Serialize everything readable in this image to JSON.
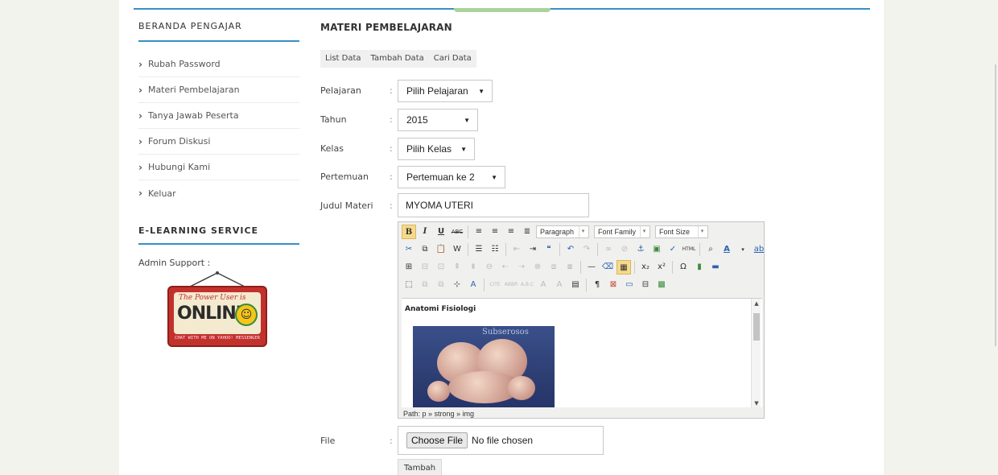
{
  "sidebar": {
    "title": "BERANDA PENGAJAR",
    "items": [
      {
        "label": "Rubah Password"
      },
      {
        "label": "Materi Pembelajaran"
      },
      {
        "label": "Tanya Jawab Peserta"
      },
      {
        "label": "Forum Diskusi"
      },
      {
        "label": "Hubungi Kami"
      },
      {
        "label": "Keluar"
      }
    ],
    "service_title": "E-LEARNING SERVICE",
    "admin_label": "Admin Support :",
    "sign": {
      "small": "The Power User is",
      "big": "ONLINE",
      "foot": "CHAT WITH ME ON YAHOO! MESSENGER"
    }
  },
  "main": {
    "title": "MATERI PEMBELAJARAN",
    "tabs": [
      {
        "label": "List Data"
      },
      {
        "label": "Tambah Data"
      },
      {
        "label": "Cari Data"
      }
    ],
    "colon": ":",
    "fields": {
      "pelajaran": {
        "label": "Pelajaran",
        "value": "Pilih Pelajaran"
      },
      "tahun": {
        "label": "Tahun",
        "value": "2015"
      },
      "kelas": {
        "label": "Kelas",
        "value": "Pilih Kelas"
      },
      "pertemuan": {
        "label": "Pertemuan",
        "value": "Pertemuan ke 2"
      },
      "judul": {
        "label": "Judul Materi",
        "value": "MYOMA UTERI"
      },
      "file": {
        "label": "File",
        "button": "Choose File",
        "status": "No file chosen"
      }
    },
    "editor": {
      "format_dropdown": "Paragraph",
      "font_family_dropdown": "Font Family",
      "font_size_dropdown": "Font Size",
      "content_heading": "Anatomi Fisiologi",
      "image_label": "Subserosos",
      "path": "Path: p » strong » img"
    },
    "submit_label": "Tambah"
  }
}
